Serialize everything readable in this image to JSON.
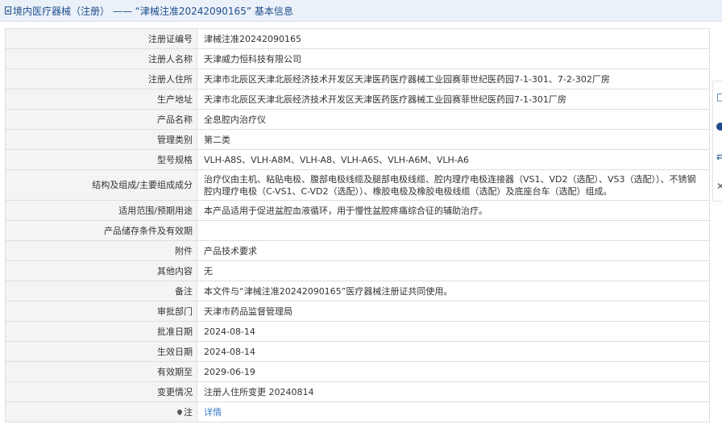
{
  "header": {
    "title": "境内医疗器械（注册） —— “津械注准20242090165” 基本信息"
  },
  "rows": [
    {
      "label": "注册证编号",
      "value": "津械注准20242090165"
    },
    {
      "label": "注册人名称",
      "value": "天津威力恒科技有限公司"
    },
    {
      "label": "注册人住所",
      "value": "天津市北辰区天津北辰经济技术开发区天津医药医疗器械工业园赛菲世纪医药园7-1-301、7-2-302厂房"
    },
    {
      "label": "生产地址",
      "value": "天津市北辰区天津北辰经济技术开发区天津医药医疗器械工业园赛菲世纪医药园7-1-301厂房"
    },
    {
      "label": "产品名称",
      "value": "全息腔内治疗仪"
    },
    {
      "label": "管理类别",
      "value": "第二类"
    },
    {
      "label": "型号规格",
      "value": "VLH-A8S、VLH-A8M、VLH-A8、VLH-A6S、VLH-A6M、VLH-A6"
    },
    {
      "label": "结构及组成/主要组成成分",
      "value": "治疗仪由主机、粘贴电极、腹部电极线缆及腿部电极线缆、腔内理疗电极连接器（VS1、VD2（选配）、VS3（选配））、不锈钢腔内理疗电极（C-VS1、C-VD2（选配））、橡胶电极及橡胶电极线缆（选配）及底座台车（选配）组成。"
    },
    {
      "label": "适用范围/预期用途",
      "value": "本产品适用于促进盆腔血液循环，用于慢性盆腔疼痛综合征的辅助治疗。"
    },
    {
      "label": "产品储存条件及有效期",
      "value": ""
    },
    {
      "label": "附件",
      "value": "产品技术要求"
    },
    {
      "label": "其他内容",
      "value": "无"
    },
    {
      "label": "备注",
      "value": "本文件与“津械注准20242090165”医疗器械注册证共同使用。"
    },
    {
      "label": "审批部门",
      "value": "天津市药品监督管理局"
    },
    {
      "label": "批准日期",
      "value": "2024-08-14"
    },
    {
      "label": "生效日期",
      "value": "2024-08-14"
    },
    {
      "label": "有效期至",
      "value": "2029-06-19"
    },
    {
      "label": "变更情况",
      "value": "注册人住所变更 20240814"
    },
    {
      "label": "注",
      "value": "详情"
    }
  ],
  "icons": {
    "header": "document-icon",
    "note": "pin-icon"
  },
  "colors": {
    "header_bg": "#eaf1f8",
    "header_text": "#1f4e8c",
    "label_bg": "#f4f4f4",
    "link": "#3a7dc9"
  }
}
